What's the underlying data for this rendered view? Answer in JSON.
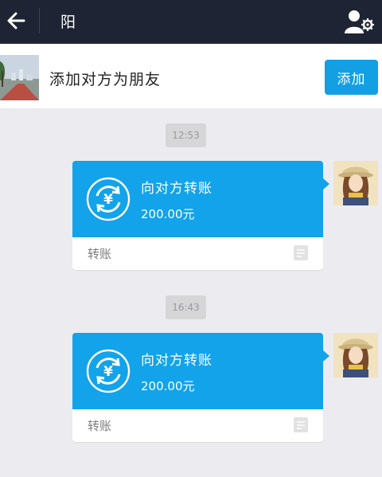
{
  "header": {
    "title": "阳"
  },
  "add_friend_bar": {
    "text": "添加对方为朋友",
    "button_label": "添加"
  },
  "messages": [
    {
      "time": "12:53",
      "title": "向对方转账",
      "amount": "200.00元",
      "footer_label": "转账"
    },
    {
      "time": "16:43",
      "title": "向对方转账",
      "amount": "200.00元",
      "footer_label": "转账"
    }
  ],
  "colors": {
    "topbar": "#1e2433",
    "accent_blue": "#12a3ea",
    "button_blue": "#129fe3",
    "chat_background": "#ececf0"
  },
  "icons": [
    "back-arrow-icon",
    "contact-settings-icon",
    "yen-transfer-icon",
    "document-icon"
  ]
}
